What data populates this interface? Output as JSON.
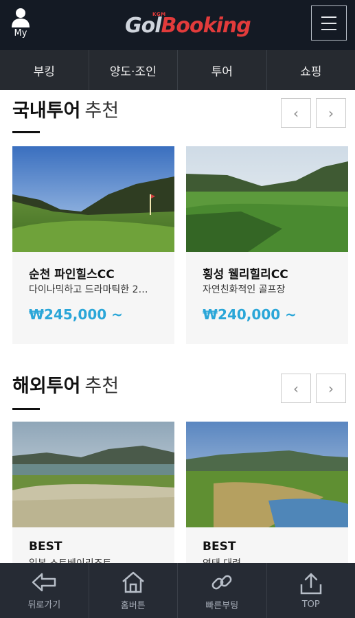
{
  "header": {
    "my_label": "My",
    "logo_small": "KGM",
    "logo_part1": "Gol",
    "logo_part2": "Booking"
  },
  "nav": {
    "items": [
      "부킹",
      "양도·조인",
      "투어",
      "쇼핑"
    ]
  },
  "domestic": {
    "title_bold": "국내투어",
    "title_rest": "추천",
    "cards": [
      {
        "name": "순천 파인힐스CC",
        "desc": "다이나믹하고 드라마틱한 2…",
        "price": "₩245,000 ~"
      },
      {
        "name": "횡성 웰리힐리CC",
        "desc": "자연친화적인 골프장",
        "price": "₩240,000 ~"
      }
    ]
  },
  "overseas": {
    "title_bold": "해외투어",
    "title_rest": "추천",
    "cards": [
      {
        "name": "BEST",
        "desc": "일본 스트베이리조트"
      },
      {
        "name": "BEST",
        "desc": "연태 대련"
      }
    ]
  },
  "arrows": {
    "prev": "‹",
    "next": "›"
  },
  "bottom": {
    "items": [
      {
        "label": "뒤로가기",
        "icon": "back-arrow-icon"
      },
      {
        "label": "홈버튼",
        "icon": "home-icon"
      },
      {
        "label": "빠른부팅",
        "icon": "link-icon"
      },
      {
        "label": "TOP",
        "icon": "upload-top-icon"
      }
    ]
  },
  "colors": {
    "header_bg": "#141a24",
    "nav_bg": "#262a30",
    "accent_red": "#e23b3b",
    "price_blue": "#2aa6d8"
  }
}
